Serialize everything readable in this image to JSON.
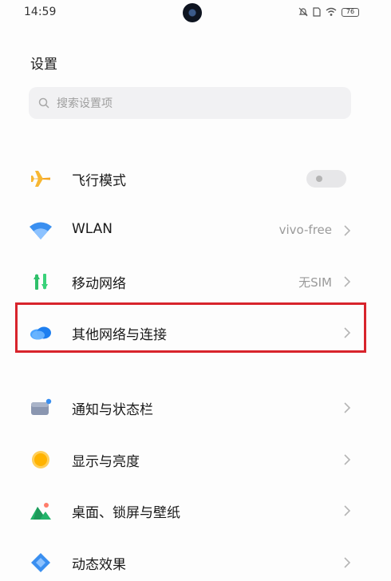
{
  "status_bar": {
    "time": "14:59",
    "battery": "76"
  },
  "page": {
    "title": "设置"
  },
  "search": {
    "placeholder": "搜索设置项"
  },
  "settings": [
    {
      "id": "airplane",
      "label": "飞行模式",
      "icon": "airplane-icon",
      "toggle": false
    },
    {
      "id": "wlan",
      "label": "WLAN",
      "icon": "wifi-icon",
      "value": "vivo-free"
    },
    {
      "id": "mobile",
      "label": "移动网络",
      "icon": "mobile-data-icon",
      "value": "无SIM"
    },
    {
      "id": "other-network",
      "label": "其他网络与连接",
      "icon": "cloud-icon",
      "highlighted": true
    },
    {
      "id": "notifications",
      "label": "通知与状态栏",
      "icon": "notification-icon"
    },
    {
      "id": "display",
      "label": "显示与亮度",
      "icon": "sun-icon"
    },
    {
      "id": "wallpaper",
      "label": "桌面、锁屏与壁纸",
      "icon": "landscape-icon"
    },
    {
      "id": "effects",
      "label": "动态效果",
      "icon": "diamond-icon"
    }
  ],
  "colors": {
    "highlight": "#d8242c",
    "accent_blue": "#3a8ff0"
  }
}
